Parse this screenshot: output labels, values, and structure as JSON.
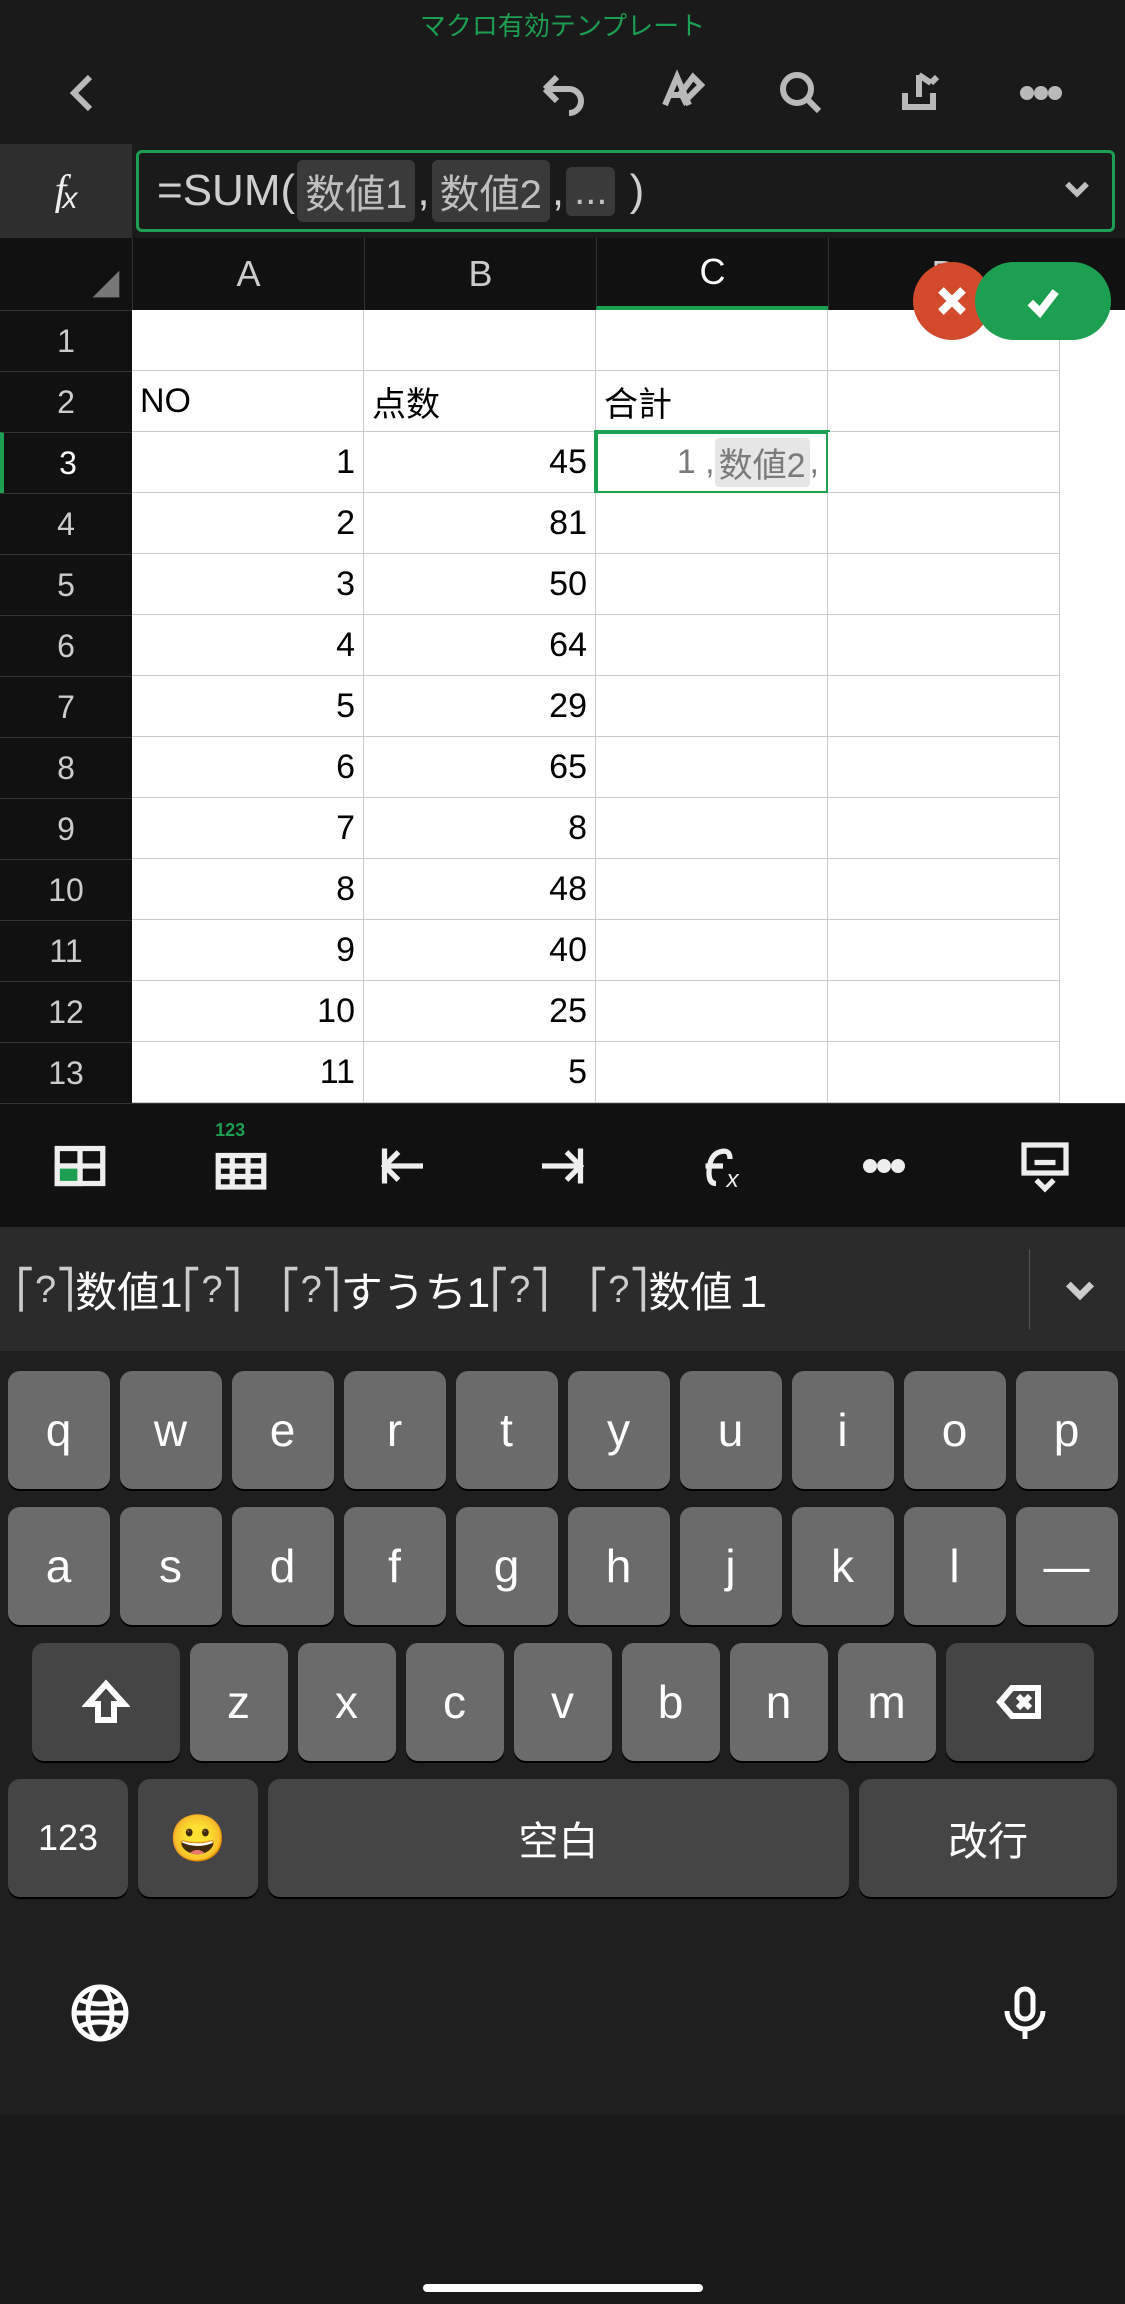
{
  "title": "マクロ有効テンプレート",
  "formula": {
    "prefix": "=SUM(",
    "arg1": "数値1",
    "arg2": "数値2",
    "arg3": "...",
    "suffix": ")"
  },
  "columns": [
    "A",
    "B",
    "C",
    "D"
  ],
  "rows": [
    {
      "n": "1",
      "A": "",
      "B": "",
      "C": ""
    },
    {
      "n": "2",
      "A": "NO",
      "B": "点数",
      "C": "合計"
    },
    {
      "n": "3",
      "A": "1",
      "B": "45",
      "C": "active"
    },
    {
      "n": "4",
      "A": "2",
      "B": "81",
      "C": ""
    },
    {
      "n": "5",
      "A": "3",
      "B": "50",
      "C": ""
    },
    {
      "n": "6",
      "A": "4",
      "B": "64",
      "C": ""
    },
    {
      "n": "7",
      "A": "5",
      "B": "29",
      "C": ""
    },
    {
      "n": "8",
      "A": "6",
      "B": "65",
      "C": ""
    },
    {
      "n": "9",
      "A": "7",
      "B": "8",
      "C": ""
    },
    {
      "n": "10",
      "A": "8",
      "B": "48",
      "C": ""
    },
    {
      "n": "11",
      "A": "9",
      "B": "40",
      "C": ""
    },
    {
      "n": "12",
      "A": "10",
      "B": "25",
      "C": ""
    },
    {
      "n": "13",
      "A": "11",
      "B": "5",
      "C": ""
    }
  ],
  "active_cell_display": {
    "pre": "1 , ",
    "arg": "数値2",
    "post": " ,"
  },
  "edit_toolbar_badge": "123",
  "suggestions": [
    "数値1",
    "すうち1",
    "数値１"
  ],
  "keyboard": {
    "row1": [
      "q",
      "w",
      "e",
      "r",
      "t",
      "y",
      "u",
      "i",
      "o",
      "p"
    ],
    "row2": [
      "a",
      "s",
      "d",
      "f",
      "g",
      "h",
      "j",
      "k",
      "l",
      "—"
    ],
    "row3": [
      "z",
      "x",
      "c",
      "v",
      "b",
      "n",
      "m"
    ],
    "num_key": "123",
    "space": "空白",
    "return": "改行"
  }
}
